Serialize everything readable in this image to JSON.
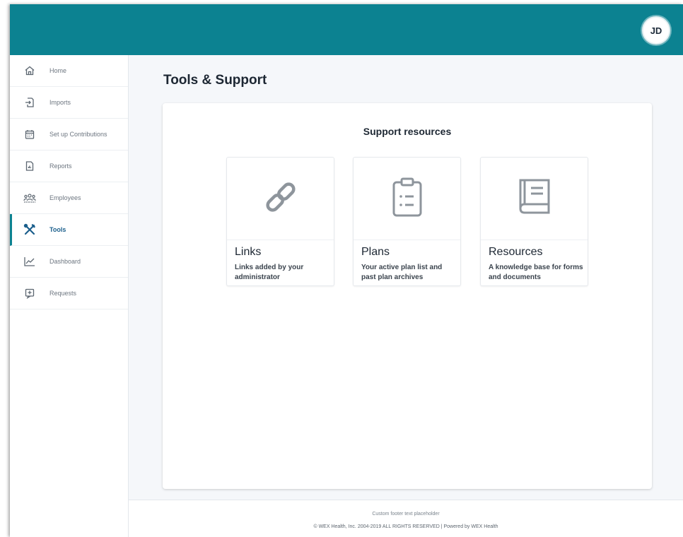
{
  "header": {
    "avatar_initials": "JD",
    "brand_color": "#0c8291"
  },
  "sidebar": {
    "items": [
      {
        "label": "Home",
        "icon": "home-icon"
      },
      {
        "label": "Imports",
        "icon": "import-icon"
      },
      {
        "label": "Set up Contributions",
        "icon": "calendar-icon"
      },
      {
        "label": "Reports",
        "icon": "report-icon"
      },
      {
        "label": "Employees",
        "icon": "employees-icon"
      },
      {
        "label": "Tools",
        "icon": "tools-icon",
        "active": true
      },
      {
        "label": "Dashboard",
        "icon": "chart-icon"
      },
      {
        "label": "Requests",
        "icon": "request-icon"
      }
    ]
  },
  "main": {
    "title": "Tools & Support",
    "panel_title": "Support resources",
    "cards": [
      {
        "title": "Links",
        "description": "Links added by your administrator",
        "icon": "link-icon"
      },
      {
        "title": "Plans",
        "description": "Your active plan list and past plan archives",
        "icon": "clipboard-icon"
      },
      {
        "title": "Resources",
        "description": "A knowledge base for forms and documents",
        "icon": "book-icon"
      }
    ]
  },
  "footer": {
    "line1": "Custom footer text placeholder",
    "line2": "© WEX Health, Inc. 2004-2019 ALL RIGHTS RESERVED | Powered by WEX Health"
  }
}
